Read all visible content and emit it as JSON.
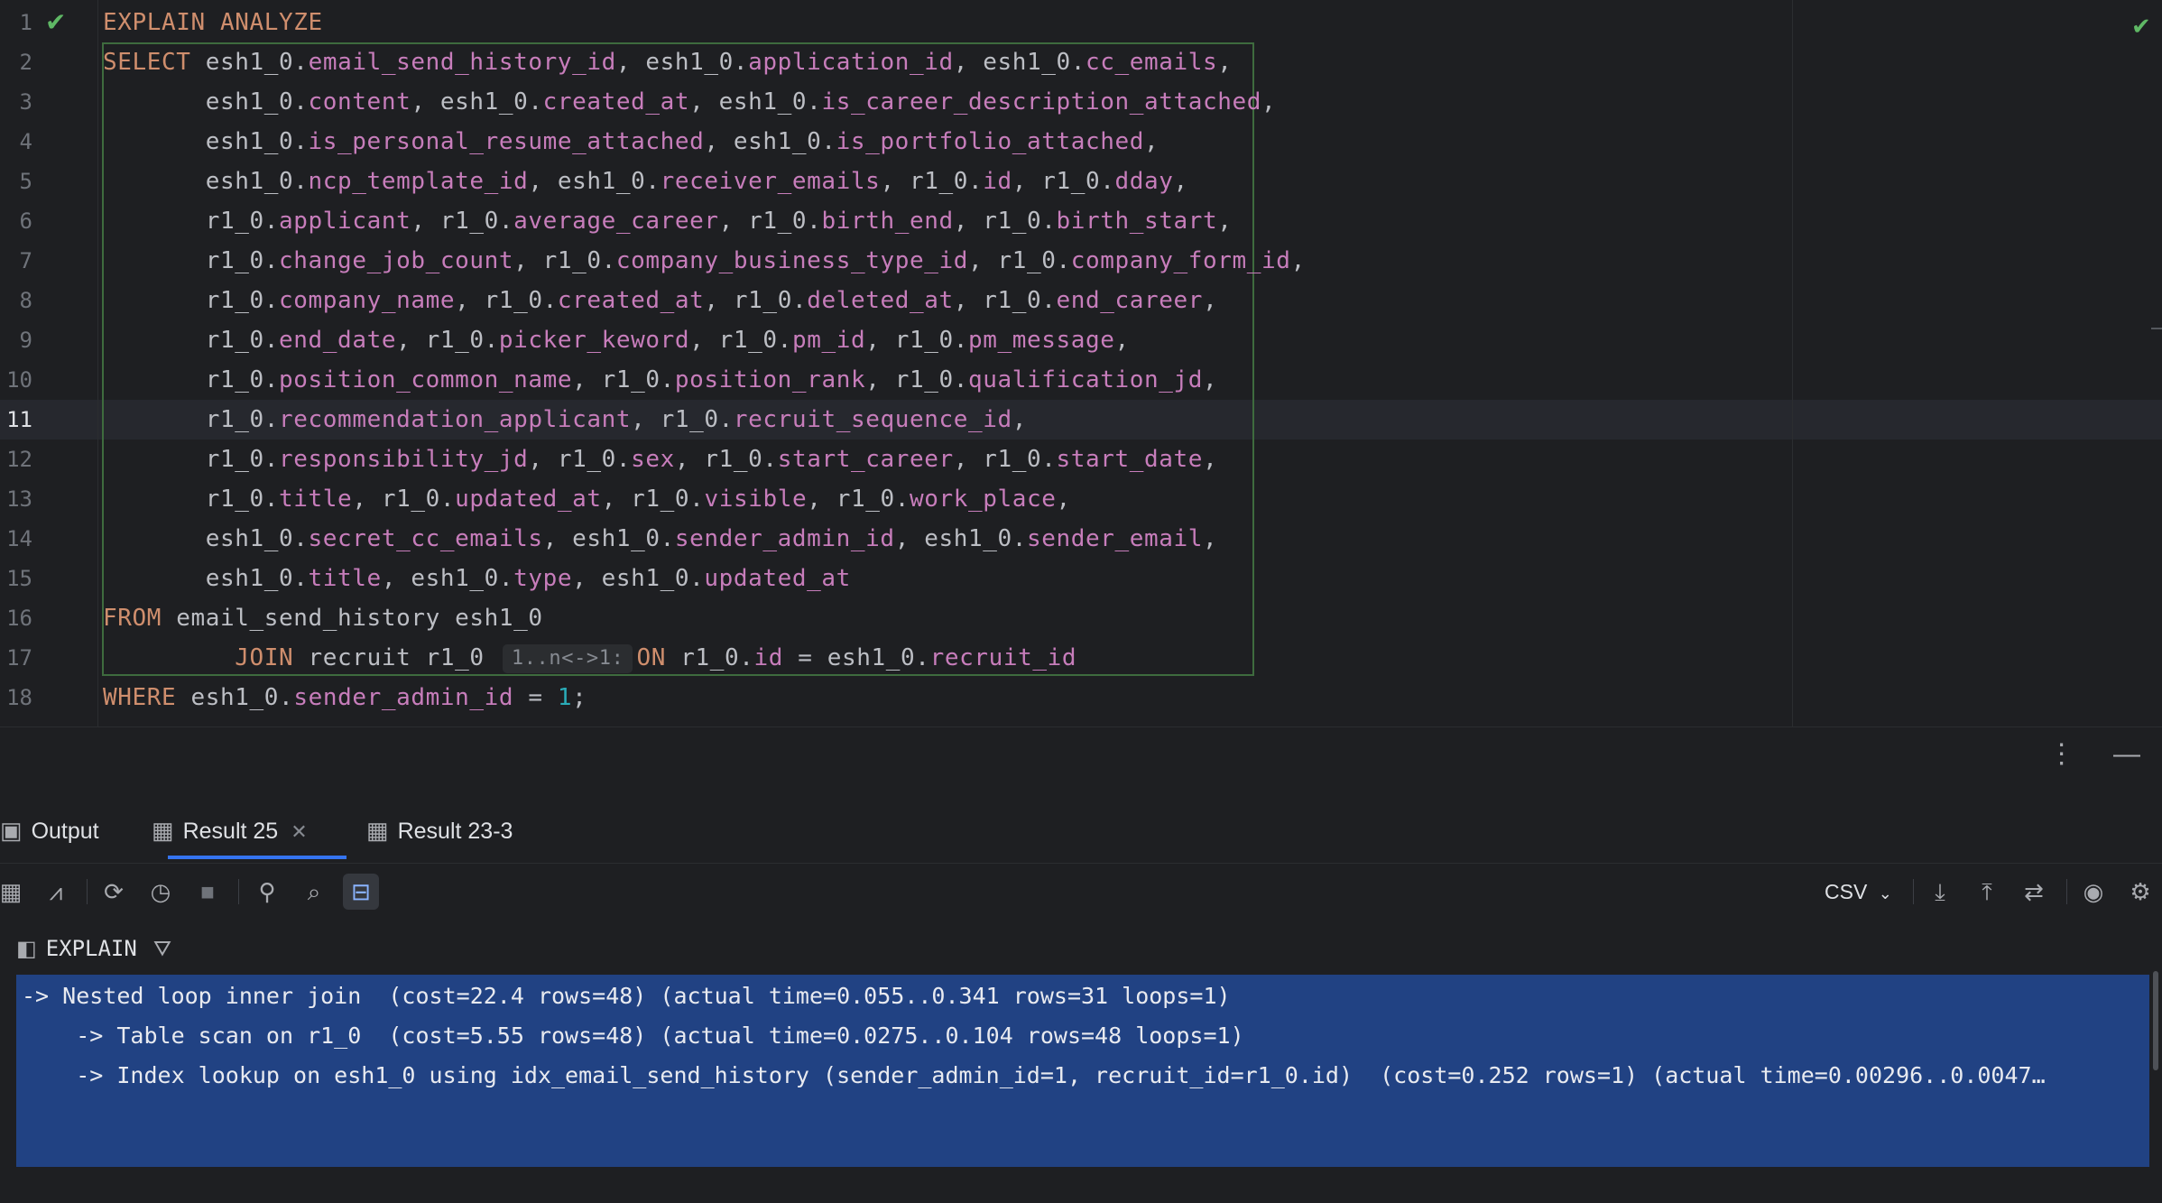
{
  "editor": {
    "lines": [
      {
        "n": "1",
        "segs": [
          [
            "kw",
            "EXPLAIN ANALYZE"
          ]
        ]
      },
      {
        "n": "2",
        "segs": [
          [
            "kw",
            "SELECT"
          ],
          [
            "t",
            " esh1_0."
          ],
          [
            "f",
            "email_send_history_id"
          ],
          [
            "t",
            ", esh1_0."
          ],
          [
            "f",
            "application_id"
          ],
          [
            "t",
            ", esh1_0."
          ],
          [
            "f",
            "cc_emails"
          ],
          [
            "t",
            ","
          ]
        ]
      },
      {
        "n": "3",
        "segs": [
          [
            "t",
            "       esh1_0."
          ],
          [
            "f",
            "content"
          ],
          [
            "t",
            ", esh1_0."
          ],
          [
            "f",
            "created_at"
          ],
          [
            "t",
            ", esh1_0."
          ],
          [
            "f",
            "is_career_description_attached"
          ],
          [
            "t",
            ","
          ]
        ]
      },
      {
        "n": "4",
        "segs": [
          [
            "t",
            "       esh1_0."
          ],
          [
            "f",
            "is_personal_resume_attached"
          ],
          [
            "t",
            ", esh1_0."
          ],
          [
            "f",
            "is_portfolio_attached"
          ],
          [
            "t",
            ","
          ]
        ]
      },
      {
        "n": "5",
        "segs": [
          [
            "t",
            "       esh1_0."
          ],
          [
            "f",
            "ncp_template_id"
          ],
          [
            "t",
            ", esh1_0."
          ],
          [
            "f",
            "receiver_emails"
          ],
          [
            "t",
            ", r1_0."
          ],
          [
            "f",
            "id"
          ],
          [
            "t",
            ", r1_0."
          ],
          [
            "f",
            "dday"
          ],
          [
            "t",
            ","
          ]
        ]
      },
      {
        "n": "6",
        "segs": [
          [
            "t",
            "       r1_0."
          ],
          [
            "f",
            "applicant"
          ],
          [
            "t",
            ", r1_0."
          ],
          [
            "f",
            "average_career"
          ],
          [
            "t",
            ", r1_0."
          ],
          [
            "f",
            "birth_end"
          ],
          [
            "t",
            ", r1_0."
          ],
          [
            "f",
            "birth_start"
          ],
          [
            "t",
            ","
          ]
        ]
      },
      {
        "n": "7",
        "segs": [
          [
            "t",
            "       r1_0."
          ],
          [
            "f",
            "change_job_count"
          ],
          [
            "t",
            ", r1_0."
          ],
          [
            "f",
            "company_business_type_id"
          ],
          [
            "t",
            ", r1_0."
          ],
          [
            "f",
            "company_form_id"
          ],
          [
            "t",
            ","
          ]
        ]
      },
      {
        "n": "8",
        "segs": [
          [
            "t",
            "       r1_0."
          ],
          [
            "f",
            "company_name"
          ],
          [
            "t",
            ", r1_0."
          ],
          [
            "f",
            "created_at"
          ],
          [
            "t",
            ", r1_0."
          ],
          [
            "f",
            "deleted_at"
          ],
          [
            "t",
            ", r1_0."
          ],
          [
            "f",
            "end_career"
          ],
          [
            "t",
            ","
          ]
        ]
      },
      {
        "n": "9",
        "segs": [
          [
            "t",
            "       r1_0."
          ],
          [
            "f",
            "end_date"
          ],
          [
            "t",
            ", r1_0."
          ],
          [
            "f",
            "picker_keword"
          ],
          [
            "t",
            ", r1_0."
          ],
          [
            "f",
            "pm_id"
          ],
          [
            "t",
            ", r1_0."
          ],
          [
            "f",
            "pm_message"
          ],
          [
            "t",
            ","
          ]
        ]
      },
      {
        "n": "10",
        "segs": [
          [
            "t",
            "       r1_0."
          ],
          [
            "f",
            "position_common_name"
          ],
          [
            "t",
            ", r1_0."
          ],
          [
            "f",
            "position_rank"
          ],
          [
            "t",
            ", r1_0."
          ],
          [
            "f",
            "qualification_jd"
          ],
          [
            "t",
            ","
          ]
        ]
      },
      {
        "n": "11",
        "segs": [
          [
            "t",
            "       r1_0."
          ],
          [
            "f",
            "recommendation_applicant"
          ],
          [
            "t",
            ", r1_0."
          ],
          [
            "f",
            "recruit_sequence_id"
          ],
          [
            "t",
            ","
          ]
        ]
      },
      {
        "n": "12",
        "segs": [
          [
            "t",
            "       r1_0."
          ],
          [
            "f",
            "responsibility_jd"
          ],
          [
            "t",
            ", r1_0."
          ],
          [
            "f",
            "sex"
          ],
          [
            "t",
            ", r1_0."
          ],
          [
            "f",
            "start_career"
          ],
          [
            "t",
            ", r1_0."
          ],
          [
            "f",
            "start_date"
          ],
          [
            "t",
            ","
          ]
        ]
      },
      {
        "n": "13",
        "segs": [
          [
            "t",
            "       r1_0."
          ],
          [
            "f",
            "title"
          ],
          [
            "t",
            ", r1_0."
          ],
          [
            "f",
            "updated_at"
          ],
          [
            "t",
            ", r1_0."
          ],
          [
            "f",
            "visible"
          ],
          [
            "t",
            ", r1_0."
          ],
          [
            "f",
            "work_place"
          ],
          [
            "t",
            ","
          ]
        ]
      },
      {
        "n": "14",
        "segs": [
          [
            "t",
            "       esh1_0."
          ],
          [
            "f",
            "secret_cc_emails"
          ],
          [
            "t",
            ", esh1_0."
          ],
          [
            "f",
            "sender_admin_id"
          ],
          [
            "t",
            ", esh1_0."
          ],
          [
            "f",
            "sender_email"
          ],
          [
            "t",
            ","
          ]
        ]
      },
      {
        "n": "15",
        "segs": [
          [
            "t",
            "       esh1_0."
          ],
          [
            "f",
            "title"
          ],
          [
            "t",
            ", esh1_0."
          ],
          [
            "f",
            "type"
          ],
          [
            "t",
            ", esh1_0."
          ],
          [
            "f",
            "updated_at"
          ]
        ]
      },
      {
        "n": "16",
        "segs": [
          [
            "kw",
            "FROM"
          ],
          [
            "t",
            " email_send_history esh1_0"
          ]
        ]
      },
      {
        "n": "17",
        "segs": [
          [
            "t",
            "         "
          ],
          [
            "kw",
            "JOIN"
          ],
          [
            "t",
            " recruit r1_0 "
          ],
          [
            "inlay",
            "1..n<->1:"
          ],
          [
            "kw",
            "ON"
          ],
          [
            "t",
            " r1_0."
          ],
          [
            "f",
            "id"
          ],
          [
            "t",
            " = esh1_0."
          ],
          [
            "f",
            "recruit_id"
          ]
        ]
      },
      {
        "n": "18",
        "segs": [
          [
            "kw",
            "WHERE"
          ],
          [
            "t",
            " esh1_0."
          ],
          [
            "f",
            "sender_admin_id"
          ],
          [
            "t",
            " = "
          ],
          [
            "num",
            "1"
          ],
          [
            "t",
            ";"
          ]
        ]
      }
    ],
    "active_line": "11"
  },
  "tabs": [
    {
      "label": "Output",
      "icon": "console-icon"
    },
    {
      "label": "Result 25",
      "icon": "table-icon",
      "closable": true,
      "active": true
    },
    {
      "label": "Result 23-3",
      "icon": "table-icon"
    }
  ],
  "toolbar": {
    "export_format": "CSV",
    "buttons": [
      "table-view",
      "chart-view",
      "refresh",
      "history",
      "stop",
      "pin",
      "search",
      "filter-view",
      "download",
      "upload",
      "compare",
      "view",
      "settings"
    ]
  },
  "result": {
    "header": "EXPLAIN",
    "lines": [
      "-> Nested loop inner join  (cost=22.4 rows=48) (actual time=0.055..0.341 rows=31 loops=1)",
      "    -> Table scan on r1_0  (cost=5.55 rows=48) (actual time=0.0275..0.104 rows=48 loops=1)",
      "    -> Index lookup on esh1_0 using idx_email_send_history (sender_admin_id=1, recruit_id=r1_0.id)  (cost=0.252 rows=1) (actual time=0.00296..0.0047…"
    ]
  },
  "colors": {
    "background": "#1e1f22",
    "keyword": "#cf8e6d",
    "field": "#c77dbb",
    "number": "#2aacb8",
    "selection": "#214283",
    "accent": "#3574f0",
    "check": "#5fb865"
  }
}
